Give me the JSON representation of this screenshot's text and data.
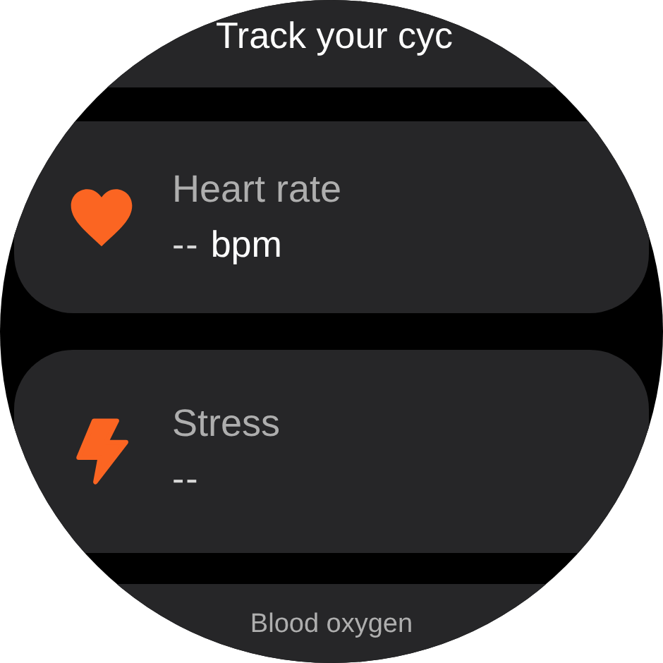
{
  "header": {
    "title": "Track your cyc"
  },
  "tiles": [
    {
      "kind": "heart",
      "label": "Heart rate",
      "value": "--",
      "unit": "bpm"
    },
    {
      "kind": "stress",
      "label": "Stress",
      "value": "--"
    }
  ],
  "next_tile": {
    "label": "Blood oxygen"
  }
}
